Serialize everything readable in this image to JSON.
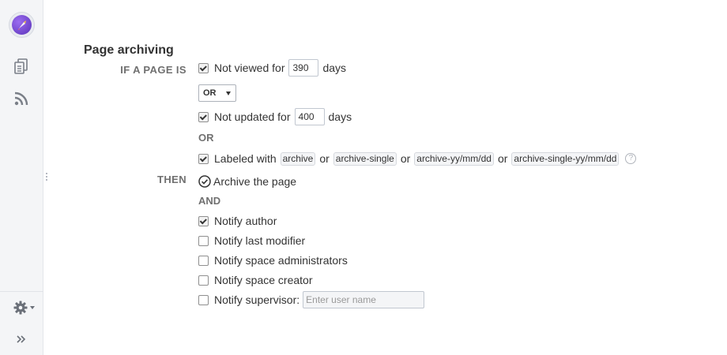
{
  "section": {
    "title": "Page archiving"
  },
  "labels": {
    "if_a_page_is": "IF A PAGE IS",
    "then": "THEN"
  },
  "conditions": {
    "not_viewed": {
      "checked": true,
      "label_before": "Not viewed for",
      "value": "390",
      "label_after": "days"
    },
    "operator": {
      "selected": "OR"
    },
    "not_updated": {
      "checked": true,
      "label_before": "Not updated for",
      "value": "400",
      "label_after": "days"
    },
    "or_text": "OR",
    "labeled": {
      "checked": true,
      "label": "Labeled with",
      "tags": [
        "archive",
        "archive-single",
        "archive-yy/mm/dd",
        "archive-single-yy/mm/dd"
      ],
      "separator": "or"
    }
  },
  "actions": {
    "archive": "Archive the page",
    "and_text": "AND",
    "notify_author": {
      "checked": true,
      "label": "Notify author"
    },
    "notify_last_modifier": {
      "checked": false,
      "label": "Notify last modifier"
    },
    "notify_space_admins": {
      "checked": false,
      "label": "Notify space administrators"
    },
    "notify_space_creator": {
      "checked": false,
      "label": "Notify space creator"
    },
    "notify_supervisor": {
      "checked": false,
      "label": "Notify supervisor:",
      "placeholder": "Enter user name"
    }
  },
  "icons": {
    "logo": "rocket-logo-icon",
    "pages": "pages-icon",
    "feed": "rss-feed-icon",
    "settings": "gear-icon",
    "expand": "double-chevron-right-icon",
    "help": "question-circle-icon",
    "check_circle": "check-circle-icon"
  },
  "colors": {
    "sidebar_bg": "#f4f5f7",
    "label_gray": "#707070",
    "text": "#333333",
    "logo_purple": "#7a4ed8"
  }
}
